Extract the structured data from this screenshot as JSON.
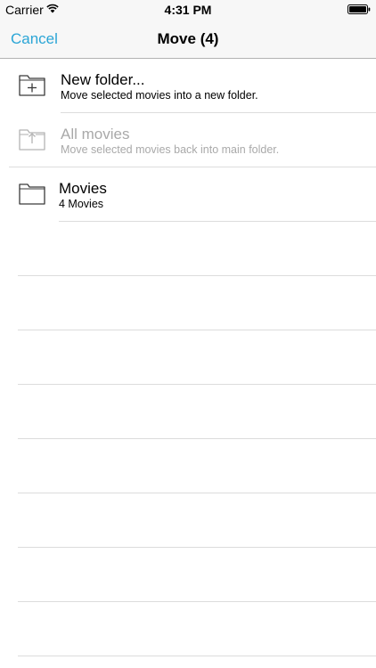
{
  "status_bar": {
    "carrier": "Carrier",
    "time": "4:31 PM",
    "wifi_icon": "wifi-icon",
    "battery_icon": "battery-icon"
  },
  "nav_bar": {
    "cancel_label": "Cancel",
    "title": "Move (4)",
    "accent_color": "#2aa5d6"
  },
  "rows": [
    {
      "title": "New folder...",
      "subtitle": "Move selected movies into a new folder.",
      "icon": "folder-plus-icon",
      "enabled": true
    },
    {
      "title": "All movies",
      "subtitle": "Move selected movies back into main folder.",
      "icon": "folder-up-icon",
      "enabled": false
    },
    {
      "title": "Movies",
      "subtitle": "4 Movies",
      "icon": "folder-icon",
      "enabled": true
    }
  ],
  "colors": {
    "disabled_text": "#a9a9a9",
    "separator": "#dcdcdc"
  }
}
